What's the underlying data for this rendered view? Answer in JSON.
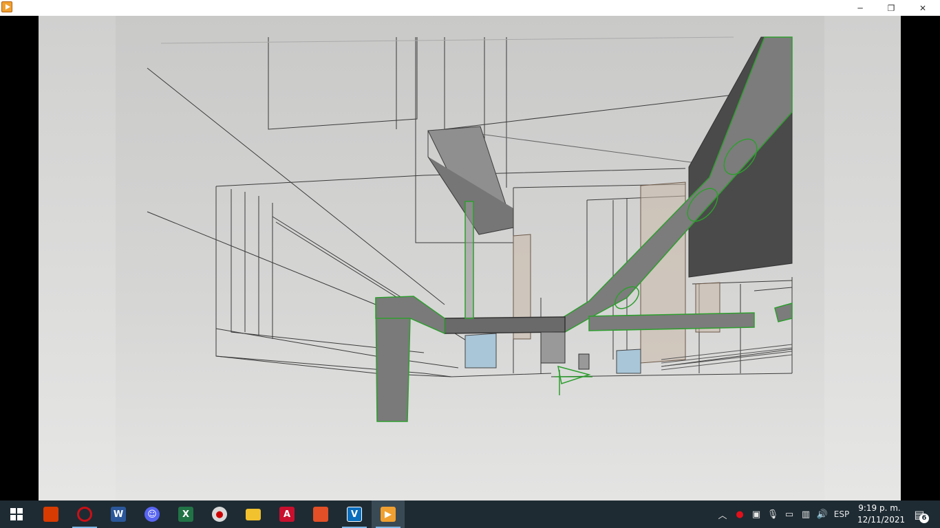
{
  "window": {
    "title": "",
    "controls": {
      "minimize": "─",
      "restore": "❐",
      "close": "✕"
    }
  },
  "taskbar": {
    "apps": [
      {
        "name": "start-button",
        "icon": "windows-logo-icon",
        "color": "#ffffff"
      },
      {
        "name": "office-app",
        "icon": "office-icon",
        "color": "#d83b01"
      },
      {
        "name": "opera-app",
        "icon": "opera-icon",
        "color": "#cc0f16"
      },
      {
        "name": "word-app",
        "icon": "word-icon",
        "color": "#2b579a",
        "glyph": "W"
      },
      {
        "name": "discord-app",
        "icon": "discord-icon",
        "color": "#5865f2"
      },
      {
        "name": "excel-app",
        "icon": "excel-icon",
        "color": "#217346",
        "glyph": "X"
      },
      {
        "name": "paint-app",
        "icon": "palette-icon",
        "color": "#d9d9d9"
      },
      {
        "name": "file-explorer-app",
        "icon": "folder-icon",
        "color": "#f2c12e"
      },
      {
        "name": "autocad-app",
        "icon": "autocad-icon",
        "color": "#c8102e",
        "glyph": "A"
      },
      {
        "name": "acrobat-app",
        "icon": "acrobat-icon",
        "color": "#e34f26"
      },
      {
        "name": "vegas-app",
        "icon": "vegas-icon",
        "color": "#0a6ebd",
        "glyph": "V"
      },
      {
        "name": "media-player-app",
        "icon": "play-icon",
        "color": "#f0a030"
      }
    ],
    "tray": {
      "language": "ESP",
      "time": "9:19 p. m.",
      "date": "12/11/2021",
      "notifications": "6"
    }
  }
}
